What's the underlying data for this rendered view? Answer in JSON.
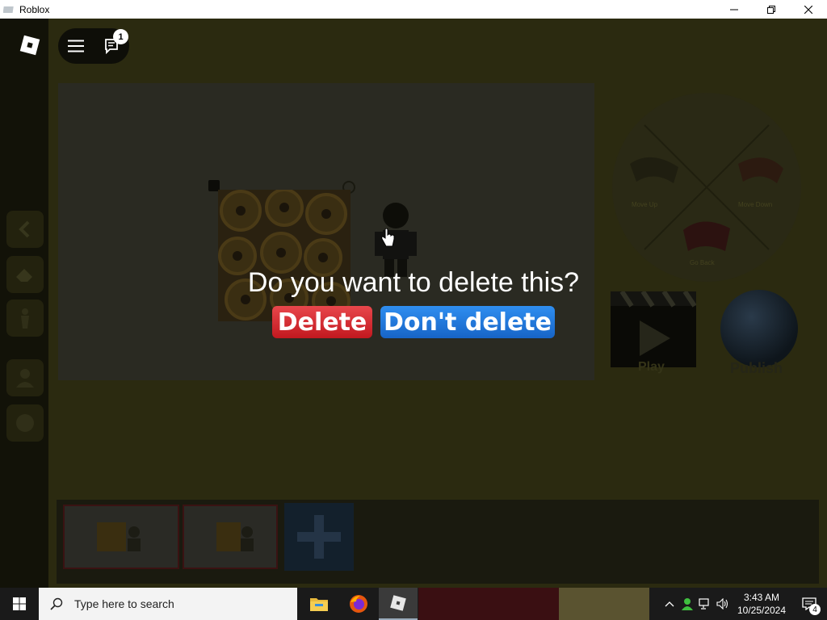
{
  "window": {
    "title": "Roblox"
  },
  "topbar": {
    "chat_badge": "1"
  },
  "stage": {
    "radial_menu": {
      "options": [
        "Move Up",
        "Move Down",
        "Go Back"
      ]
    },
    "play_label": "Play",
    "publish_label": "Publish"
  },
  "dialog": {
    "question": "Do you want to delete this?",
    "delete_label": "Delete",
    "keep_label": "Don't delete",
    "delete_color": "#d9282f",
    "keep_color": "#1f7ee0"
  },
  "taskbar": {
    "search_placeholder": "Type here to search",
    "time": "3:43 AM",
    "date": "10/25/2024",
    "notification_count": "4",
    "apps": [
      "file-explorer-icon",
      "firefox-icon",
      "roblox-icon"
    ]
  }
}
